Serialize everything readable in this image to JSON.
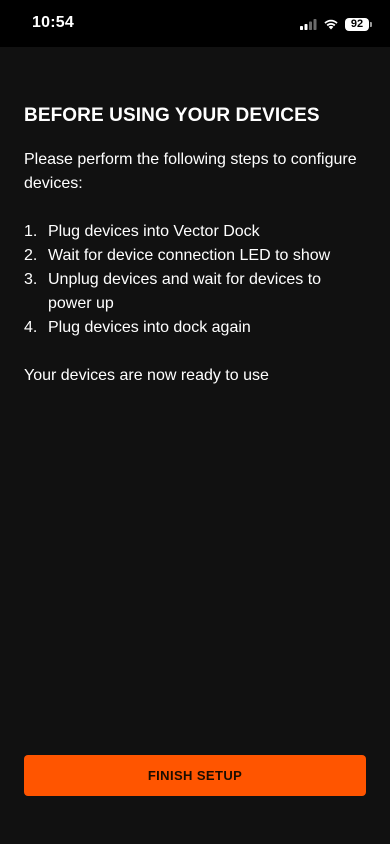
{
  "status_bar": {
    "time": "10:54",
    "battery": "92",
    "icons": [
      "cellular-signal-icon",
      "wifi-icon",
      "battery-icon"
    ]
  },
  "page": {
    "title": "BEFORE USING YOUR DEVICES",
    "intro": "Please perform the following steps to configure devices:",
    "steps": [
      {
        "number": "1.",
        "text": "Plug devices into Vector Dock"
      },
      {
        "number": "2.",
        "text": "Wait for device connection LED to show"
      },
      {
        "number": "3.",
        "text": "Unplug devices and wait for devices to power up"
      },
      {
        "number": "4.",
        "text": "Plug devices into dock again"
      }
    ],
    "ready_text": "Your devices are now ready to use"
  },
  "actions": {
    "finish_label": "FINISH SETUP"
  },
  "colors": {
    "background": "#111111",
    "status_bar": "#000000",
    "accent": "#ff5500",
    "text": "#ffffff"
  }
}
